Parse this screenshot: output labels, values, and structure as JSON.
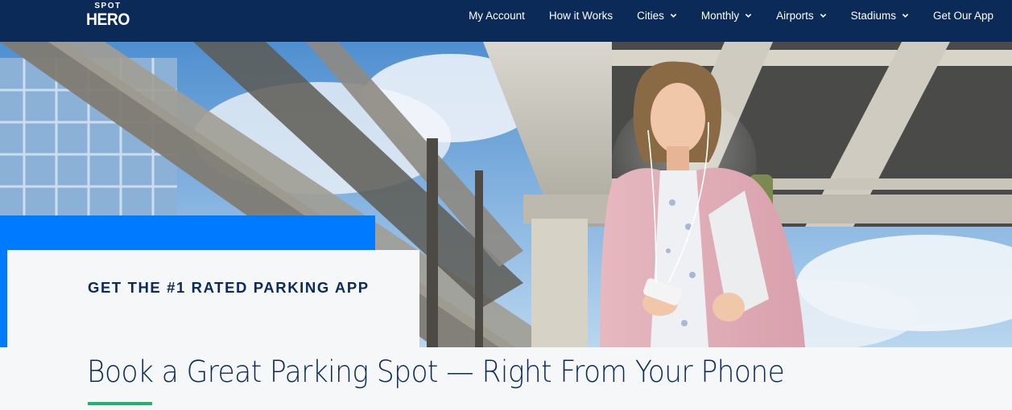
{
  "brand": {
    "logo_top": "SPOT",
    "logo_bottom": "HERO"
  },
  "nav": {
    "items": [
      {
        "label": "My Account",
        "dropdown": false
      },
      {
        "label": "How it Works",
        "dropdown": false
      },
      {
        "label": "Cities",
        "dropdown": true
      },
      {
        "label": "Monthly",
        "dropdown": true
      },
      {
        "label": "Airports",
        "dropdown": true
      },
      {
        "label": "Stadiums",
        "dropdown": true
      },
      {
        "label": "Get Our App",
        "dropdown": false
      }
    ]
  },
  "hero": {
    "tagline": "GET THE #1 RATED PARKING APP",
    "image_subject": "woman-using-phone-in-parking-garage"
  },
  "headline": {
    "title": "Book a Great Parking Spot — Right From Your Phone"
  },
  "colors": {
    "navbar": "#0b2a57",
    "accent_blue": "#007bff",
    "accent_green": "#1fb36e",
    "text_dark": "#0b2a57",
    "background": "#f5f7f9"
  }
}
